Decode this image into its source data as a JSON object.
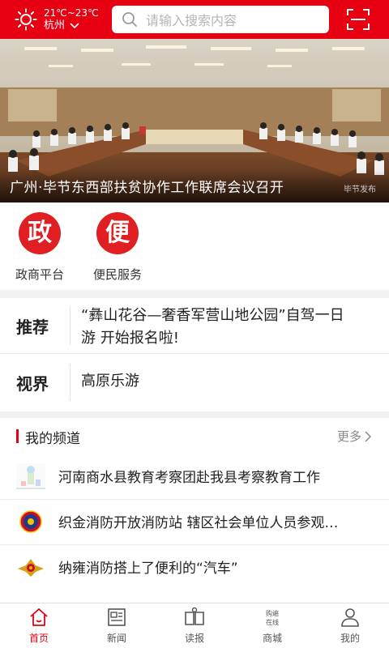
{
  "header": {
    "temperature": "21℃~23℃",
    "city": "杭州",
    "search_placeholder": "请输入搜索内容"
  },
  "banner": {
    "title": "广州·毕节东西部扶贫协作工作联席会议召开",
    "watermark": "毕节发布"
  },
  "services": [
    {
      "glyph": "政",
      "label": "政商平台"
    },
    {
      "glyph": "便",
      "label": "便民服务"
    }
  ],
  "recommend": {
    "label": "推荐",
    "text_line1": "“彝山花谷—奢香军营山地公园”自驾一日",
    "text_line2": "游 开始报名啦!"
  },
  "vision": {
    "label": "视界",
    "text": "高原乐游"
  },
  "channel": {
    "title": "我的频道",
    "more": "更多",
    "items": [
      "河南商水县教育考察团赴我县考察教育工作",
      "织金消防开放消防站  辖区社会单位人员参观…",
      "纳雍消防搭上了便利的“汽车”"
    ]
  },
  "nav": [
    {
      "label": "首页"
    },
    {
      "label": "新闻"
    },
    {
      "label": "读报"
    },
    {
      "label": "商城",
      "icon_text_1": "购遍",
      "icon_text_2": "在线"
    },
    {
      "label": "我的"
    }
  ],
  "colors": {
    "brand_red": "#e60012",
    "service_red": "#df1f22"
  }
}
